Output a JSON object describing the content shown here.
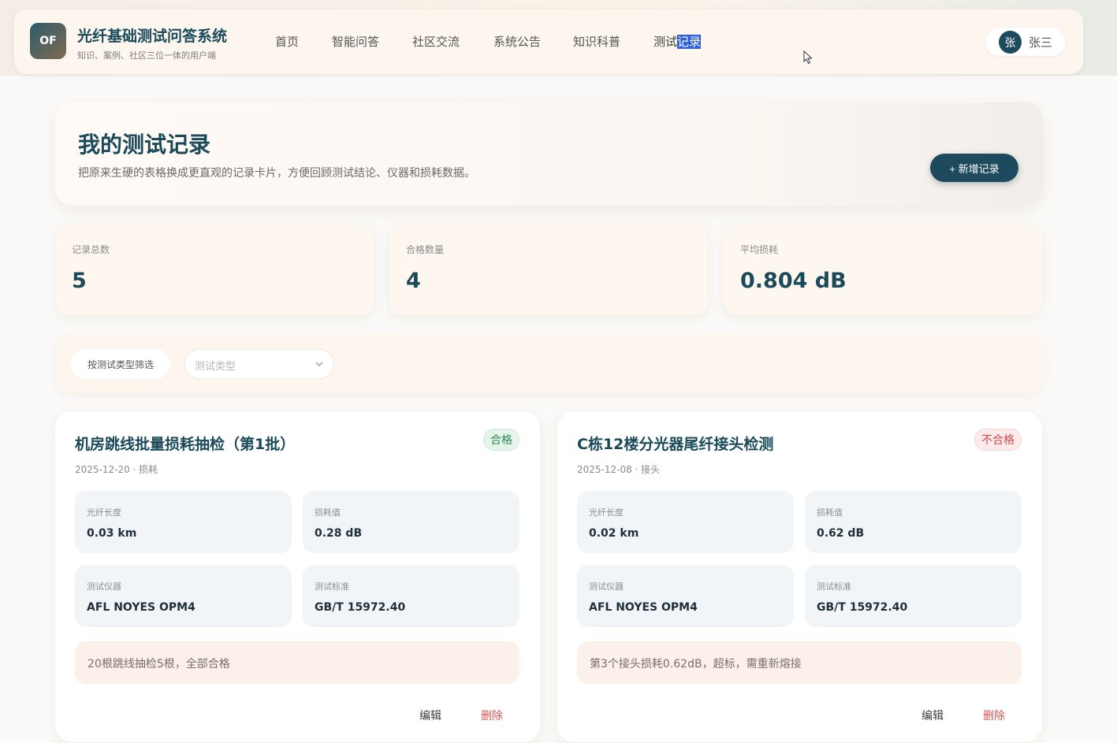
{
  "header": {
    "logo_text": "OF",
    "app_title": "光纤基础测试问答系统",
    "app_subtitle": "知识、案例、社区三位一体的用户端",
    "nav": [
      {
        "label": "首页"
      },
      {
        "label": "智能问答"
      },
      {
        "label": "社区交流"
      },
      {
        "label": "系统公告"
      },
      {
        "label": "知识科普"
      },
      {
        "label_pre": "测试",
        "label_hl": "记录"
      }
    ],
    "user": {
      "avatar": "张",
      "name": "张三"
    }
  },
  "hero": {
    "title": "我的测试记录",
    "description": "把原来生硬的表格换成更直观的记录卡片，方便回顾测试结论、仪器和损耗数据。",
    "add_button": "+ 新增记录"
  },
  "stats": [
    {
      "label": "记录总数",
      "value": "5"
    },
    {
      "label": "合格数量",
      "value": "4"
    },
    {
      "label": "平均损耗",
      "value": "0.804 dB"
    }
  ],
  "filter": {
    "chip_label": "按测试类型筛选",
    "select_placeholder": "测试类型"
  },
  "records": [
    {
      "title": "机房跳线批量损耗抽检（第1批）",
      "meta": "2025-12-20 · 损耗",
      "status": "合格",
      "fields": [
        {
          "label": "光纤长度",
          "value": "0.03 km"
        },
        {
          "label": "损耗值",
          "value": "0.28 dB"
        },
        {
          "label": "测试仪器",
          "value": "AFL NOYES OPM4"
        },
        {
          "label": "测试标准",
          "value": "GB/T 15972.40"
        }
      ],
      "note": "20根跳线抽检5根，全部合格",
      "edit": "编辑",
      "delete": "删除"
    },
    {
      "title": "C栋12楼分光器尾纤接头检测",
      "meta": "2025-12-08 · 接头",
      "status": "不合格",
      "fields": [
        {
          "label": "光纤长度",
          "value": "0.02 km"
        },
        {
          "label": "损耗值",
          "value": "0.62 dB"
        },
        {
          "label": "测试仪器",
          "value": "AFL NOYES OPM4"
        },
        {
          "label": "测试标准",
          "value": "GB/T 15972.40"
        }
      ],
      "note": "第3个接头损耗0.62dB，超标，需重新熔接",
      "edit": "编辑",
      "delete": "删除"
    }
  ],
  "colors": {
    "brand": "#1d4a5c",
    "pass": "#2e8a55",
    "fail": "#d04a4a",
    "nav_highlight": "#2f5fd8"
  }
}
